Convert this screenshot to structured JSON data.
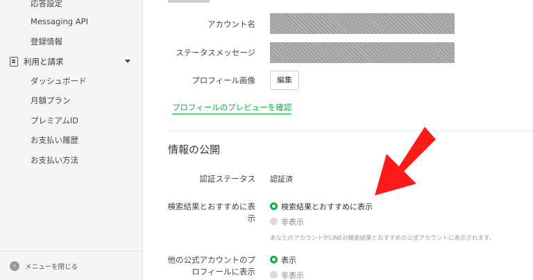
{
  "sidebar": {
    "items_top": [
      "応答設定",
      "Messaging API",
      "登録情報"
    ],
    "group": {
      "label": "利用と請求",
      "icon": "document-icon"
    },
    "sub_items": [
      "ダッシュボード",
      "月額プラン",
      "プレミアムID",
      "お支払い履歴",
      "お支払い方法"
    ],
    "footer": {
      "label": "メニューを閉じる",
      "icon": "chevron-left-icon"
    }
  },
  "profile": {
    "account_name_label": "アカウント名",
    "status_message_label": "ステータスメッセージ",
    "profile_image_label": "プロフィール画像",
    "edit_button": "編集",
    "preview_link": "プロフィールのプレビューを確認"
  },
  "info": {
    "section_title": "情報の公開",
    "cert_label": "認証ステータス",
    "cert_value": "認証済",
    "search_label_line1": "検索結果とおすすめに表",
    "search_label_line2": "示",
    "search_option_show": "検索結果とおすすめに表示",
    "search_option_hide": "非表示",
    "search_note": "あなたのアカウントがLINEの検索結果とおすすめの公式アカウントに表示されます。",
    "other_label_line1": "他の公式アカウントのプ",
    "other_label_line2": "ロフィールに表示",
    "other_option_show": "表示",
    "other_option_hide": "非表示"
  },
  "colors": {
    "accent_green": "#00b33a",
    "arrow_red": "#ff1a1a"
  }
}
